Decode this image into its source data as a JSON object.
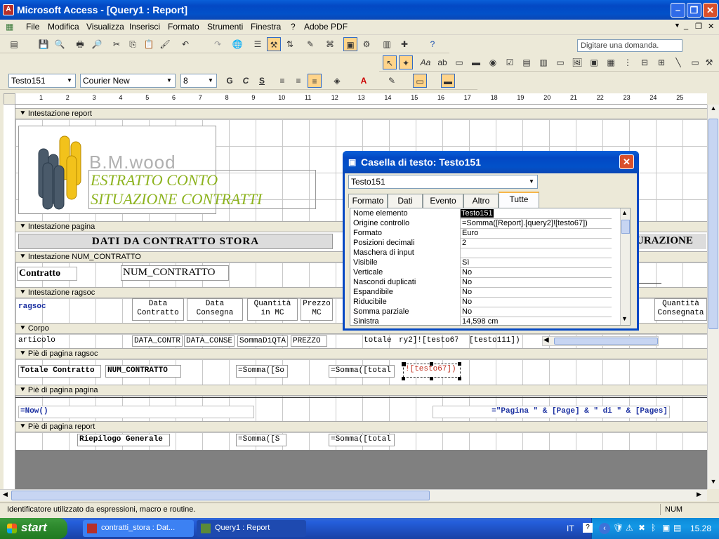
{
  "window": {
    "title": "Microsoft Access - [Query1 : Report]"
  },
  "menu": {
    "items": [
      "File",
      "Modifica",
      "Visualizza",
      "Inserisci",
      "Formato",
      "Strumenti",
      "Finestra",
      "?",
      "Adobe PDF"
    ],
    "ask_placeholder": "Digitare una domanda."
  },
  "format_toolbar": {
    "object": "Testo151",
    "font": "Courier New",
    "size": "8",
    "bold": "G",
    "italic": "C",
    "underline": "S"
  },
  "ruler": {
    "marks": [
      "1",
      "2",
      "3",
      "4",
      "5",
      "6",
      "7",
      "8",
      "9",
      "10",
      "11",
      "12",
      "13",
      "14",
      "15",
      "16",
      "17",
      "18",
      "19",
      "20",
      "21",
      "22",
      "23",
      "24",
      "25"
    ]
  },
  "report": {
    "sections": {
      "report_header": "Intestazione report",
      "page_header": "Intestazione pagina",
      "num_contratto_header": "Intestazione NUM_CONTRATTO",
      "ragsoc_header": "Intestazione ragsoc",
      "body": "Corpo",
      "ragsoc_footer": "Piè di pagina ragsoc",
      "page_footer": "Piè di pagina pagina",
      "report_footer": "Piè di pagina report"
    },
    "logo_text": "B.M.wood",
    "title_line1": "ESTRATTO CONTO",
    "title_line2": "SITUAZIONE CONTRATTI",
    "page_header_title": "DATI DA CONTRATTO STORA",
    "page_header_right": "URAZIONE",
    "contratto_label": "Contratto",
    "num_contratto_field": "NUM_CONTRATTO",
    "ragsoc_label": "ragsoc",
    "col_data_contratto_1": "Data",
    "col_data_contratto_2": "Contratto",
    "col_data_consegna_1": "Data",
    "col_data_consegna_2": "Consegna",
    "col_quantita_1": "Quantità",
    "col_quantita_2": "in MC",
    "col_prezzo_1": "Prezzo",
    "col_prezzo_2": "MC",
    "col_qcons_1": "Quantità",
    "col_qcons_2": "Consegnata",
    "body_articolo": "articolo",
    "body_data_contr": "DATA_CONTR",
    "body_data_cons": "DATA_CONSE",
    "body_somma_qta": "SommaDiQTA",
    "body_prezzo": "PREZZO",
    "body_totale": "totale",
    "body_query": "ry2]![testo67",
    "body_testo111": "[testo111])",
    "footer_totale_contratto": "Totale Contratto",
    "footer_num_contratto": "NUM_CONTRATTO",
    "footer_somma1": "=Somma([So",
    "footer_somma2": "=Somma([total",
    "footer_testo67": "![testo67])",
    "page_footer_now": "=Now()",
    "page_footer_pages": "=\"Pagina \" & [Page] & \" di \" & [Pages]",
    "riepilogo": "Riepilogo Generale",
    "report_somma1": "=Somma([S",
    "report_somma2": "=Somma([total"
  },
  "dialog": {
    "title": "Casella di testo: Testo151",
    "selector": "Testo151",
    "tabs": [
      "Formato",
      "Dati",
      "Evento",
      "Altro",
      "Tutte"
    ],
    "active_tab": "Tutte",
    "properties": [
      {
        "name": "Nome elemento",
        "value": "Testo151"
      },
      {
        "name": "Origine controllo",
        "value": "=Somma([Report].[query2]![testo67])"
      },
      {
        "name": "Formato",
        "value": "Euro"
      },
      {
        "name": "Posizioni decimali",
        "value": "2"
      },
      {
        "name": "Maschera di input",
        "value": ""
      },
      {
        "name": "Visibile",
        "value": "Sì"
      },
      {
        "name": "Verticale",
        "value": "No"
      },
      {
        "name": "Nascondi duplicati",
        "value": "No"
      },
      {
        "name": "Espandibile",
        "value": "No"
      },
      {
        "name": "Riducibile",
        "value": "No"
      },
      {
        "name": "Somma parziale",
        "value": "No"
      },
      {
        "name": "Sinistra",
        "value": "14,598 cm"
      }
    ]
  },
  "status": {
    "text": "Identificatore utilizzato da espressioni, macro e routine.",
    "num": "NUM"
  },
  "taskbar": {
    "start": "start",
    "tasks": [
      "contratti_stora : Dat...",
      "Query1 : Report"
    ],
    "lang": "IT",
    "clock": "15.28"
  },
  "colors": {
    "title_green": "#8db31f",
    "accent_blue": "#0548c4"
  }
}
